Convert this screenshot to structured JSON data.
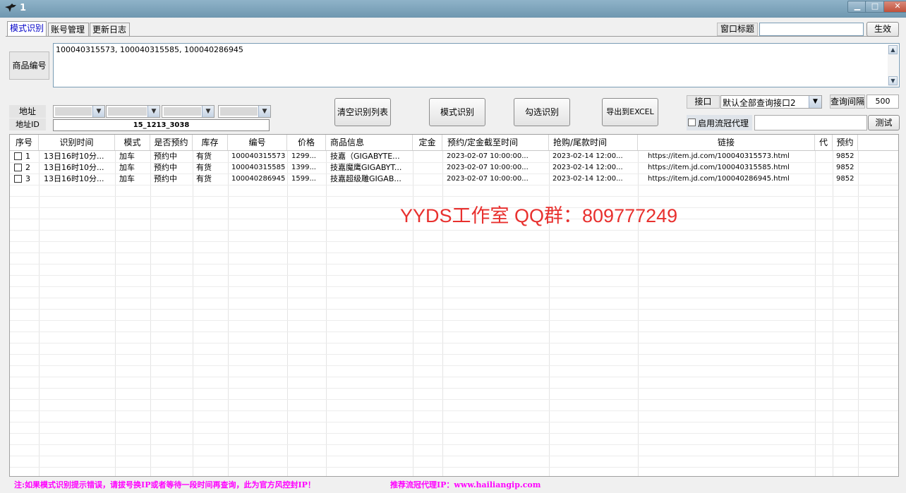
{
  "window": {
    "title": "1",
    "minimize": "▁",
    "maximize": "□",
    "close": "✕"
  },
  "tabs": [
    {
      "label": "模式识别"
    },
    {
      "label": "账号管理"
    },
    {
      "label": "更新日志"
    }
  ],
  "window_title_field": {
    "label": "窗口标题",
    "value": "",
    "apply_label": "生效"
  },
  "product_ids": {
    "label": "商品编号",
    "value": "100040315573, 100040315585, 100040286945"
  },
  "address": {
    "label": "地址",
    "id_label": "地址ID",
    "id_value": "15_1213_3038"
  },
  "buttons": {
    "clear": "清空识别列表",
    "mode_recognize": "模式识别",
    "check_recognize": "勾选识别",
    "export": "导出到EXCEL"
  },
  "interface": {
    "label": "接口",
    "selected": "默认全部查询接口2"
  },
  "query_interval": {
    "label": "查询间隔",
    "value": "500"
  },
  "proxy": {
    "checkbox_label": "启用流冠代理",
    "checked": false,
    "value": "",
    "test_label": "测试"
  },
  "table": {
    "columns": [
      "序号",
      "识别时间",
      "模式",
      "是否预约",
      "库存",
      "编号",
      "价格",
      "商品信息",
      "定金",
      "预约/定金截至时间",
      "抢购/尾款时间",
      "链接",
      "代",
      "预约"
    ],
    "rows": [
      {
        "no": "1",
        "time": "13日16时10分...",
        "mode": "加车",
        "reserve": "预约中",
        "stock": "有货",
        "id": "100040315573",
        "price": "1299...",
        "info": "技嘉（GIGABYTE...",
        "deposit": "",
        "reserve_end": "2023-02-07 10:00:00...",
        "rush_time": "2023-02-14 12:00...",
        "link": "https://item.jd.com/100040315573.html",
        "agent": "",
        "count": "9852"
      },
      {
        "no": "2",
        "time": "13日16时10分...",
        "mode": "加车",
        "reserve": "预约中",
        "stock": "有货",
        "id": "100040315585",
        "price": "1399...",
        "info": "技嘉魔鹰GIGABYT...",
        "deposit": "",
        "reserve_end": "2023-02-07 10:00:00...",
        "rush_time": "2023-02-14 12:00...",
        "link": "https://item.jd.com/100040315585.html",
        "agent": "",
        "count": "9852"
      },
      {
        "no": "3",
        "time": "13日16时10分...",
        "mode": "加车",
        "reserve": "预约中",
        "stock": "有货",
        "id": "100040286945",
        "price": "1599...",
        "info": "技嘉超级雕GIGAB...",
        "deposit": "",
        "reserve_end": "2023-02-07 10:00:00...",
        "rush_time": "2023-02-14 12:00...",
        "link": "https://item.jd.com/100040286945.html",
        "agent": "",
        "count": "9852"
      }
    ]
  },
  "watermark": "YYDS工作室  QQ群：809777249",
  "footer": {
    "note": "注:如果模式识别提示错误，请拔号换IP或者等待一段时间再查询，此为官方风控封IP！",
    "proxy_tip": "推荐流冠代理IP：www.hailiangip.com"
  },
  "colors": {
    "titlebar": "#7aa0b8",
    "watermark": "#e8302e",
    "footer": "#ff00ff",
    "active_tab": "#0000c8"
  },
  "icons": {
    "title_logo": "bird-logo-icon",
    "dropdown": "chevron-down-icon"
  }
}
